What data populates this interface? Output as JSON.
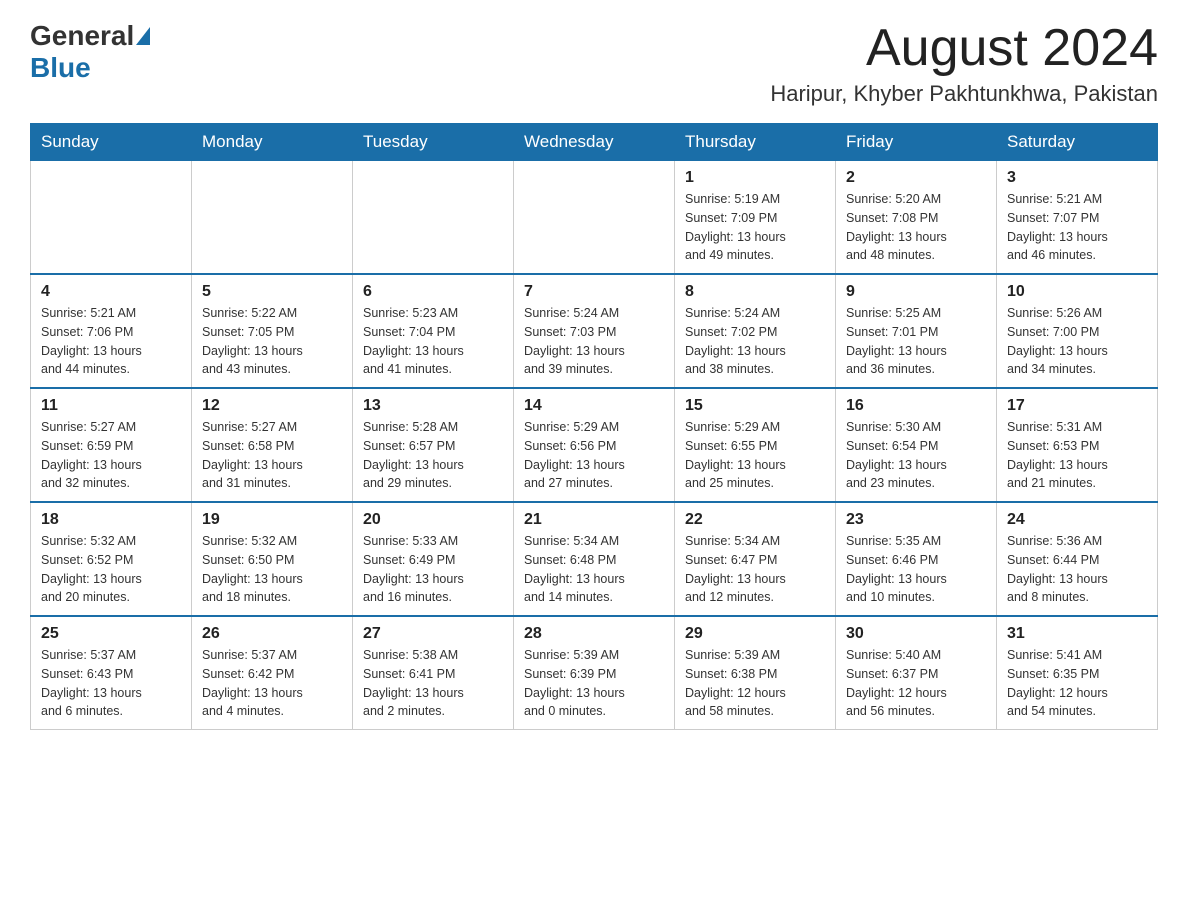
{
  "header": {
    "logo_general": "General",
    "logo_blue": "Blue",
    "month_title": "August 2024",
    "location": "Haripur, Khyber Pakhtunkhwa, Pakistan"
  },
  "weekdays": [
    "Sunday",
    "Monday",
    "Tuesday",
    "Wednesday",
    "Thursday",
    "Friday",
    "Saturday"
  ],
  "weeks": [
    [
      {
        "day": "",
        "info": ""
      },
      {
        "day": "",
        "info": ""
      },
      {
        "day": "",
        "info": ""
      },
      {
        "day": "",
        "info": ""
      },
      {
        "day": "1",
        "info": "Sunrise: 5:19 AM\nSunset: 7:09 PM\nDaylight: 13 hours\nand 49 minutes."
      },
      {
        "day": "2",
        "info": "Sunrise: 5:20 AM\nSunset: 7:08 PM\nDaylight: 13 hours\nand 48 minutes."
      },
      {
        "day": "3",
        "info": "Sunrise: 5:21 AM\nSunset: 7:07 PM\nDaylight: 13 hours\nand 46 minutes."
      }
    ],
    [
      {
        "day": "4",
        "info": "Sunrise: 5:21 AM\nSunset: 7:06 PM\nDaylight: 13 hours\nand 44 minutes."
      },
      {
        "day": "5",
        "info": "Sunrise: 5:22 AM\nSunset: 7:05 PM\nDaylight: 13 hours\nand 43 minutes."
      },
      {
        "day": "6",
        "info": "Sunrise: 5:23 AM\nSunset: 7:04 PM\nDaylight: 13 hours\nand 41 minutes."
      },
      {
        "day": "7",
        "info": "Sunrise: 5:24 AM\nSunset: 7:03 PM\nDaylight: 13 hours\nand 39 minutes."
      },
      {
        "day": "8",
        "info": "Sunrise: 5:24 AM\nSunset: 7:02 PM\nDaylight: 13 hours\nand 38 minutes."
      },
      {
        "day": "9",
        "info": "Sunrise: 5:25 AM\nSunset: 7:01 PM\nDaylight: 13 hours\nand 36 minutes."
      },
      {
        "day": "10",
        "info": "Sunrise: 5:26 AM\nSunset: 7:00 PM\nDaylight: 13 hours\nand 34 minutes."
      }
    ],
    [
      {
        "day": "11",
        "info": "Sunrise: 5:27 AM\nSunset: 6:59 PM\nDaylight: 13 hours\nand 32 minutes."
      },
      {
        "day": "12",
        "info": "Sunrise: 5:27 AM\nSunset: 6:58 PM\nDaylight: 13 hours\nand 31 minutes."
      },
      {
        "day": "13",
        "info": "Sunrise: 5:28 AM\nSunset: 6:57 PM\nDaylight: 13 hours\nand 29 minutes."
      },
      {
        "day": "14",
        "info": "Sunrise: 5:29 AM\nSunset: 6:56 PM\nDaylight: 13 hours\nand 27 minutes."
      },
      {
        "day": "15",
        "info": "Sunrise: 5:29 AM\nSunset: 6:55 PM\nDaylight: 13 hours\nand 25 minutes."
      },
      {
        "day": "16",
        "info": "Sunrise: 5:30 AM\nSunset: 6:54 PM\nDaylight: 13 hours\nand 23 minutes."
      },
      {
        "day": "17",
        "info": "Sunrise: 5:31 AM\nSunset: 6:53 PM\nDaylight: 13 hours\nand 21 minutes."
      }
    ],
    [
      {
        "day": "18",
        "info": "Sunrise: 5:32 AM\nSunset: 6:52 PM\nDaylight: 13 hours\nand 20 minutes."
      },
      {
        "day": "19",
        "info": "Sunrise: 5:32 AM\nSunset: 6:50 PM\nDaylight: 13 hours\nand 18 minutes."
      },
      {
        "day": "20",
        "info": "Sunrise: 5:33 AM\nSunset: 6:49 PM\nDaylight: 13 hours\nand 16 minutes."
      },
      {
        "day": "21",
        "info": "Sunrise: 5:34 AM\nSunset: 6:48 PM\nDaylight: 13 hours\nand 14 minutes."
      },
      {
        "day": "22",
        "info": "Sunrise: 5:34 AM\nSunset: 6:47 PM\nDaylight: 13 hours\nand 12 minutes."
      },
      {
        "day": "23",
        "info": "Sunrise: 5:35 AM\nSunset: 6:46 PM\nDaylight: 13 hours\nand 10 minutes."
      },
      {
        "day": "24",
        "info": "Sunrise: 5:36 AM\nSunset: 6:44 PM\nDaylight: 13 hours\nand 8 minutes."
      }
    ],
    [
      {
        "day": "25",
        "info": "Sunrise: 5:37 AM\nSunset: 6:43 PM\nDaylight: 13 hours\nand 6 minutes."
      },
      {
        "day": "26",
        "info": "Sunrise: 5:37 AM\nSunset: 6:42 PM\nDaylight: 13 hours\nand 4 minutes."
      },
      {
        "day": "27",
        "info": "Sunrise: 5:38 AM\nSunset: 6:41 PM\nDaylight: 13 hours\nand 2 minutes."
      },
      {
        "day": "28",
        "info": "Sunrise: 5:39 AM\nSunset: 6:39 PM\nDaylight: 13 hours\nand 0 minutes."
      },
      {
        "day": "29",
        "info": "Sunrise: 5:39 AM\nSunset: 6:38 PM\nDaylight: 12 hours\nand 58 minutes."
      },
      {
        "day": "30",
        "info": "Sunrise: 5:40 AM\nSunset: 6:37 PM\nDaylight: 12 hours\nand 56 minutes."
      },
      {
        "day": "31",
        "info": "Sunrise: 5:41 AM\nSunset: 6:35 PM\nDaylight: 12 hours\nand 54 minutes."
      }
    ]
  ]
}
